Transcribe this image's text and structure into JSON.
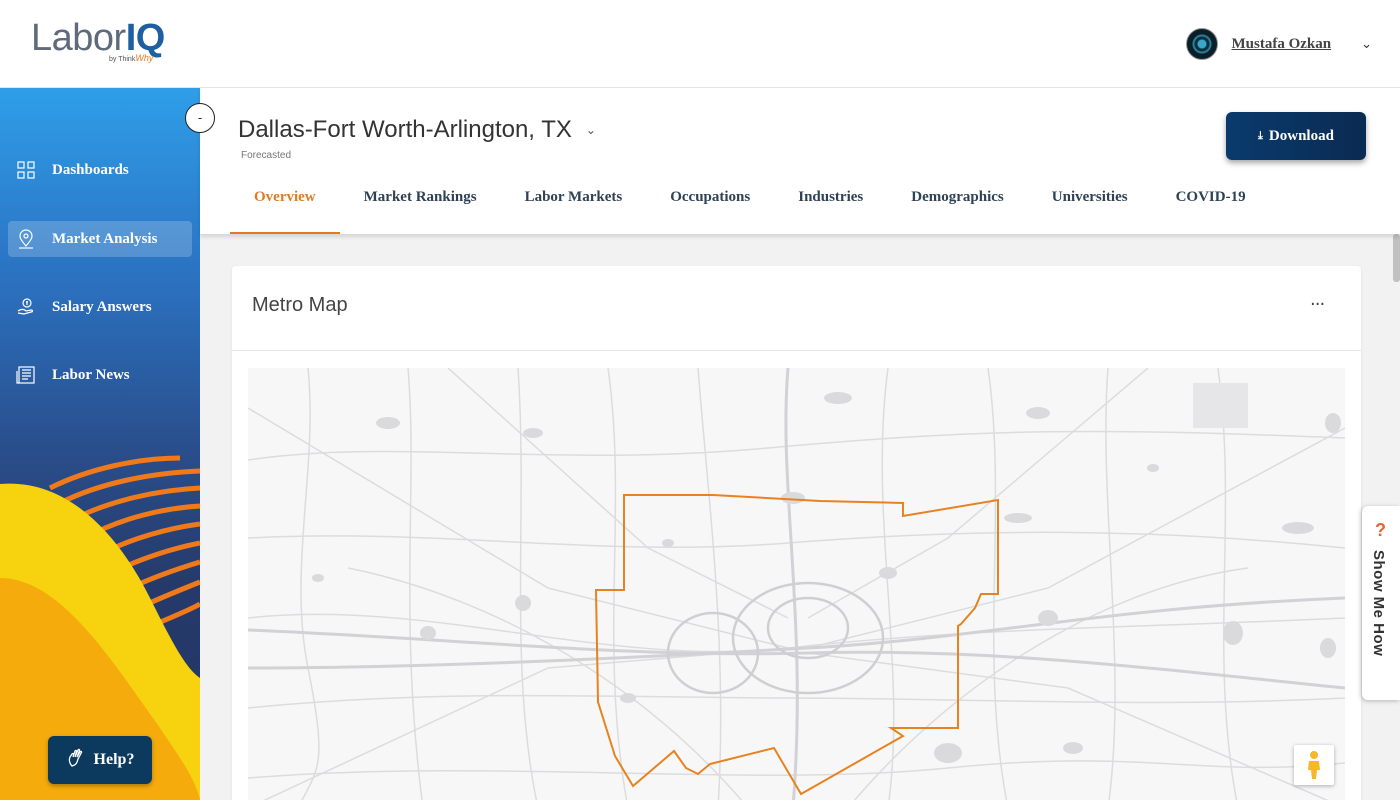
{
  "app": {
    "logo_main": "Labor",
    "logo_accent": "IQ",
    "logo_sub_prefix": "by Think",
    "logo_sub_accent": "Why"
  },
  "user": {
    "name": "Mustafa Ozkan"
  },
  "sidebar": {
    "items": [
      {
        "label": "Dashboards",
        "icon": "grid-icon",
        "active": false
      },
      {
        "label": "Market Analysis",
        "icon": "map-pin-icon",
        "active": true
      },
      {
        "label": "Salary Answers",
        "icon": "salary-hand-icon",
        "active": false
      },
      {
        "label": "Labor News",
        "icon": "newspaper-icon",
        "active": false
      }
    ],
    "collapse_symbol": "-",
    "help_label": "Help?"
  },
  "header": {
    "metro": "Dallas-Fort Worth-Arlington, TX",
    "status": "Forecasted",
    "download_label": "Download",
    "tabs": [
      {
        "label": "Overview",
        "active": true
      },
      {
        "label": "Market Rankings",
        "active": false
      },
      {
        "label": "Labor Markets",
        "active": false
      },
      {
        "label": "Occupations",
        "active": false
      },
      {
        "label": "Industries",
        "active": false
      },
      {
        "label": "Demographics",
        "active": false
      },
      {
        "label": "Universities",
        "active": false
      },
      {
        "label": "COVID-19",
        "active": false
      }
    ]
  },
  "card": {
    "title": "Metro Map",
    "more_symbol": "···"
  },
  "show_me_how": {
    "icon": "?",
    "label": "Show Me How"
  },
  "colors": {
    "accent_orange": "#e07b24",
    "nav_dark": "#0c3a5e",
    "boundary": "#e8821e"
  }
}
